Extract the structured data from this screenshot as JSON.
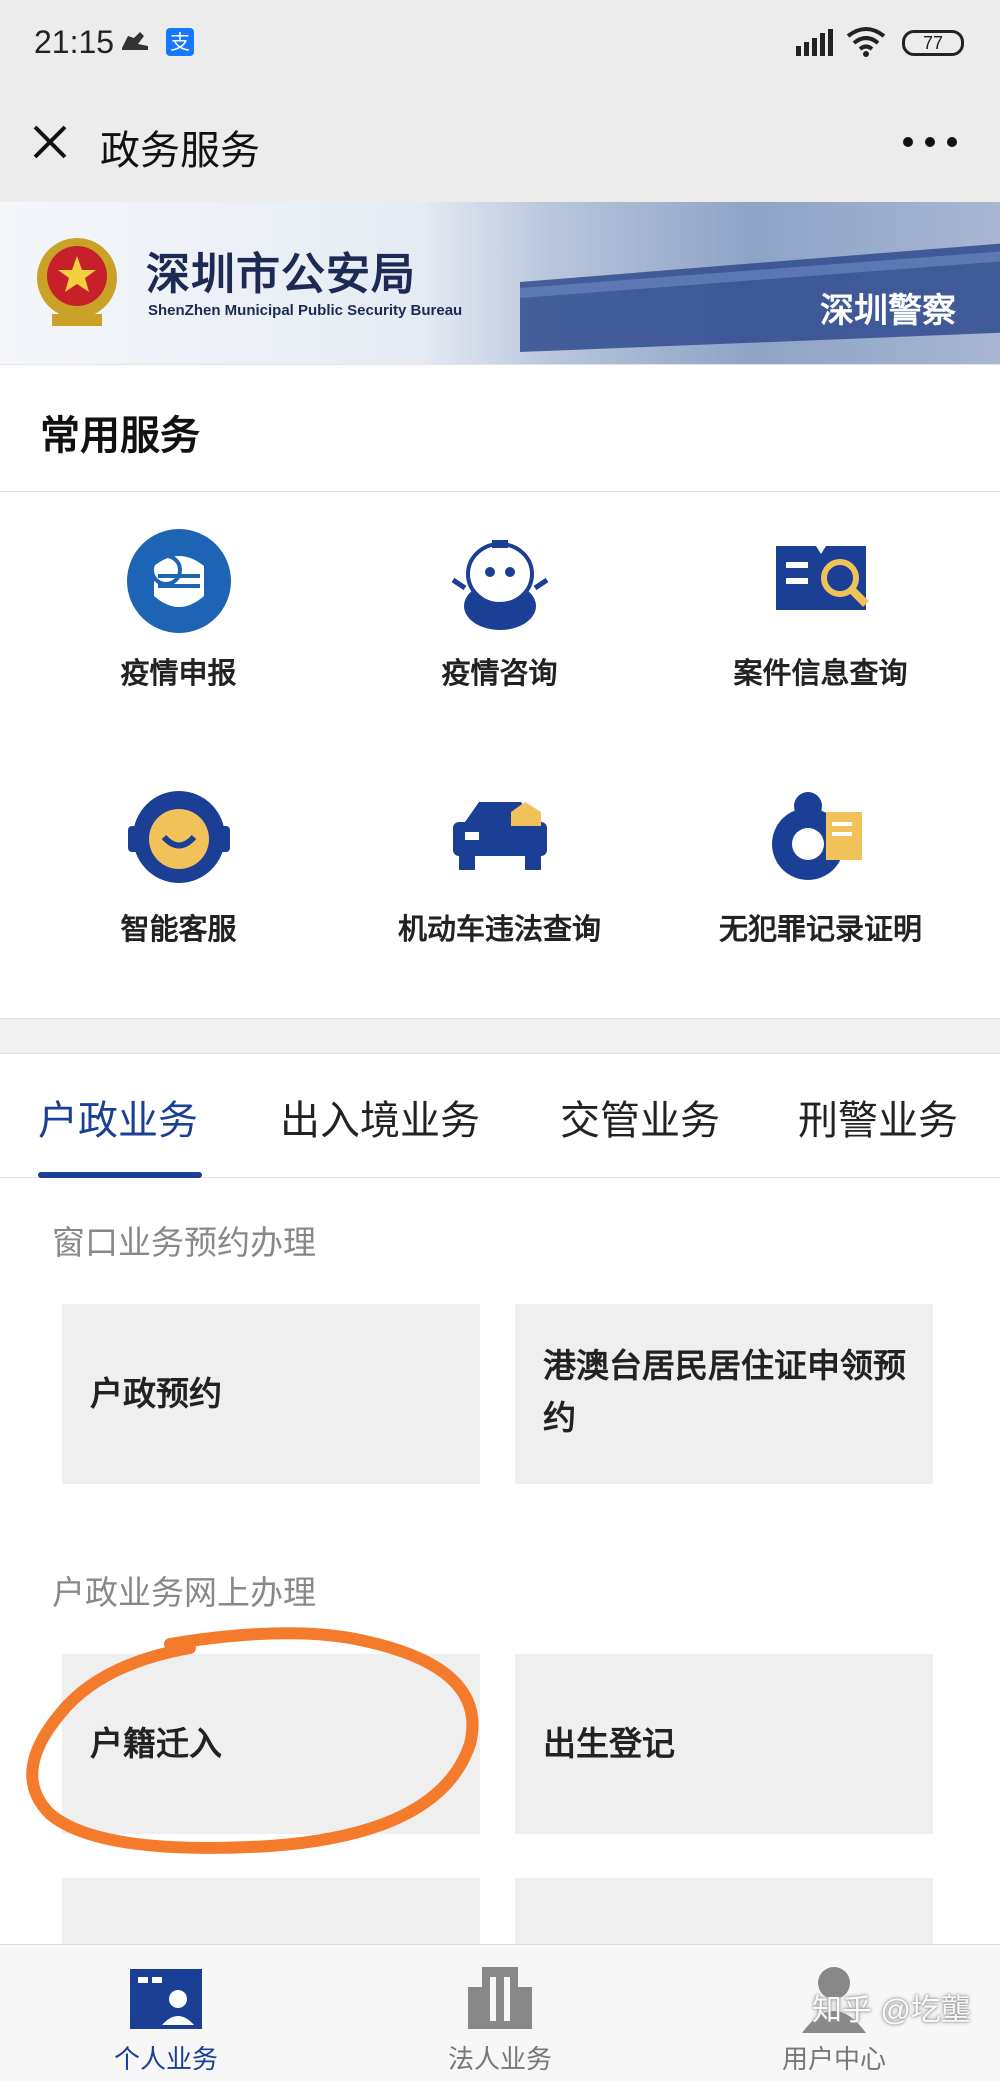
{
  "status_bar": {
    "time": "21:15",
    "battery": "77",
    "alipay_glyph": "支"
  },
  "title_bar": {
    "title": "政务服务",
    "close_icon": "close-icon",
    "more_icon": "more-icon"
  },
  "banner": {
    "title_cn": "深圳市公安局",
    "title_en": "ShenZhen Municipal Public Security Bureau",
    "sign_text": "深圳警察"
  },
  "common_services": {
    "heading": "常用服务",
    "items": [
      {
        "label": "疫情申报",
        "icon": "mask-icon"
      },
      {
        "label": "疫情咨询",
        "icon": "mascot-icon"
      },
      {
        "label": "案件信息查询",
        "icon": "document-search-icon"
      },
      {
        "label": "智能客服",
        "icon": "smiley-headset-icon"
      },
      {
        "label": "机动车违法查询",
        "icon": "police-car-icon"
      },
      {
        "label": "无犯罪记录证明",
        "icon": "certificate-icon"
      }
    ]
  },
  "tabs": [
    {
      "label": "户政业务",
      "active": true
    },
    {
      "label": "出入境业务",
      "active": false
    },
    {
      "label": "交管业务",
      "active": false
    },
    {
      "label": "刑警业务",
      "active": false
    }
  ],
  "sections": [
    {
      "title": "窗口业务预约办理",
      "cards": [
        "户政预约",
        "港澳台居民居住证申领预约"
      ]
    },
    {
      "title": "户政业务网上办理",
      "cards": [
        "户籍迁入",
        "出生登记"
      ]
    }
  ],
  "bottom_nav": [
    {
      "label": "个人业务",
      "icon": "personal-card-icon",
      "active": true
    },
    {
      "label": "法人业务",
      "icon": "building-icon",
      "active": false
    },
    {
      "label": "用户中心",
      "icon": "user-icon",
      "active": false
    }
  ],
  "watermark": "知乎 @圪壟",
  "colors": {
    "accent": "#1b3f95",
    "highlight_circle": "#f47a2c",
    "card_bg": "#efefef"
  }
}
